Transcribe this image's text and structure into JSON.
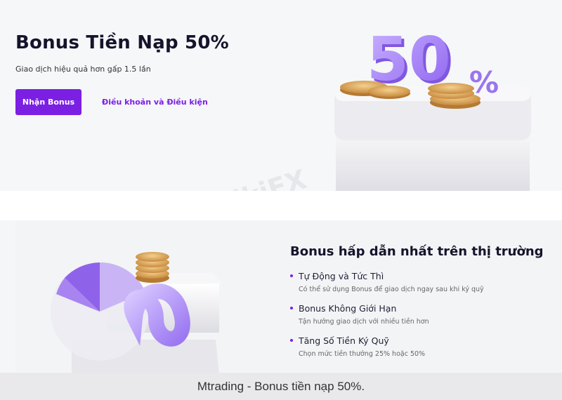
{
  "hero": {
    "title": "Bonus Tiền Nạp 50%",
    "subtitle": "Giao dịch hiệu quả hơn gấp 1.5 lần",
    "cta_label": "Nhận Bonus",
    "terms_label": "Điều khoản và Điều kiện",
    "art_text": "50",
    "art_percent": "%"
  },
  "feature": {
    "title": "Bonus hấp dẫn nhất trên thị trường",
    "items": [
      {
        "heading": "Tự Động và Tức Thì",
        "desc": "Có thể sử dụng Bonus để giao dịch ngay sau khi ký quỹ"
      },
      {
        "heading": "Bonus Không Giới Hạn",
        "desc": "Tận hưởng giao dịch với nhiều tiền hơn"
      },
      {
        "heading": "Tăng Số Tiền Ký Quỹ",
        "desc": "Chọn mức tiền thưởng 25% hoặc 50%"
      }
    ]
  },
  "watermark": "WikiFX",
  "caption": "Mtrading - Bonus tiền nạp 50%.",
  "colors": {
    "accent": "#7b1fe3",
    "background": "#f5f6f8",
    "coin": "#d9a55c"
  }
}
